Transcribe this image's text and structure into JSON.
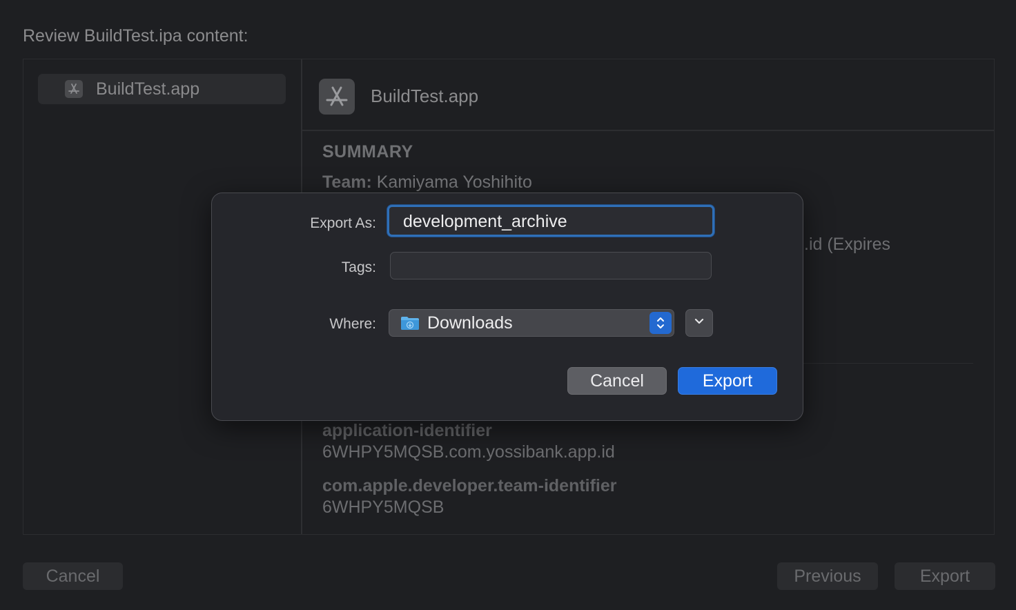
{
  "window": {
    "heading": "Review BuildTest.ipa content:",
    "sidebar": {
      "items": [
        {
          "label": "BuildTest.app",
          "icon": "app-store-icon"
        }
      ]
    },
    "app_header": {
      "title": "BuildTest.app",
      "icon": "app-store-icon"
    },
    "summary": {
      "heading": "SUMMARY",
      "team_label": "Team:",
      "team_value": "Kamiyama Yoshihito",
      "obscured_fragment": ".id (Expires"
    },
    "entitlements": [
      {
        "key": "application-identifier",
        "value": "6WHPY5MQSB.com.yossibank.app.id"
      },
      {
        "key": "com.apple.developer.team-identifier",
        "value": "6WHPY5MQSB"
      }
    ],
    "buttons": {
      "cancel": "Cancel",
      "previous": "Previous",
      "export": "Export"
    }
  },
  "sheet": {
    "export_as_label": "Export As:",
    "export_as_value": "development_archive",
    "tags_label": "Tags:",
    "tags_value": "",
    "where_label": "Where:",
    "where_value": "Downloads",
    "where_icon": "downloads-folder-icon",
    "cancel_label": "Cancel",
    "export_label": "Export"
  },
  "colors": {
    "accent": "#1f6adb",
    "focus_ring": "#2f6fb7",
    "background": "#1e1f22"
  }
}
